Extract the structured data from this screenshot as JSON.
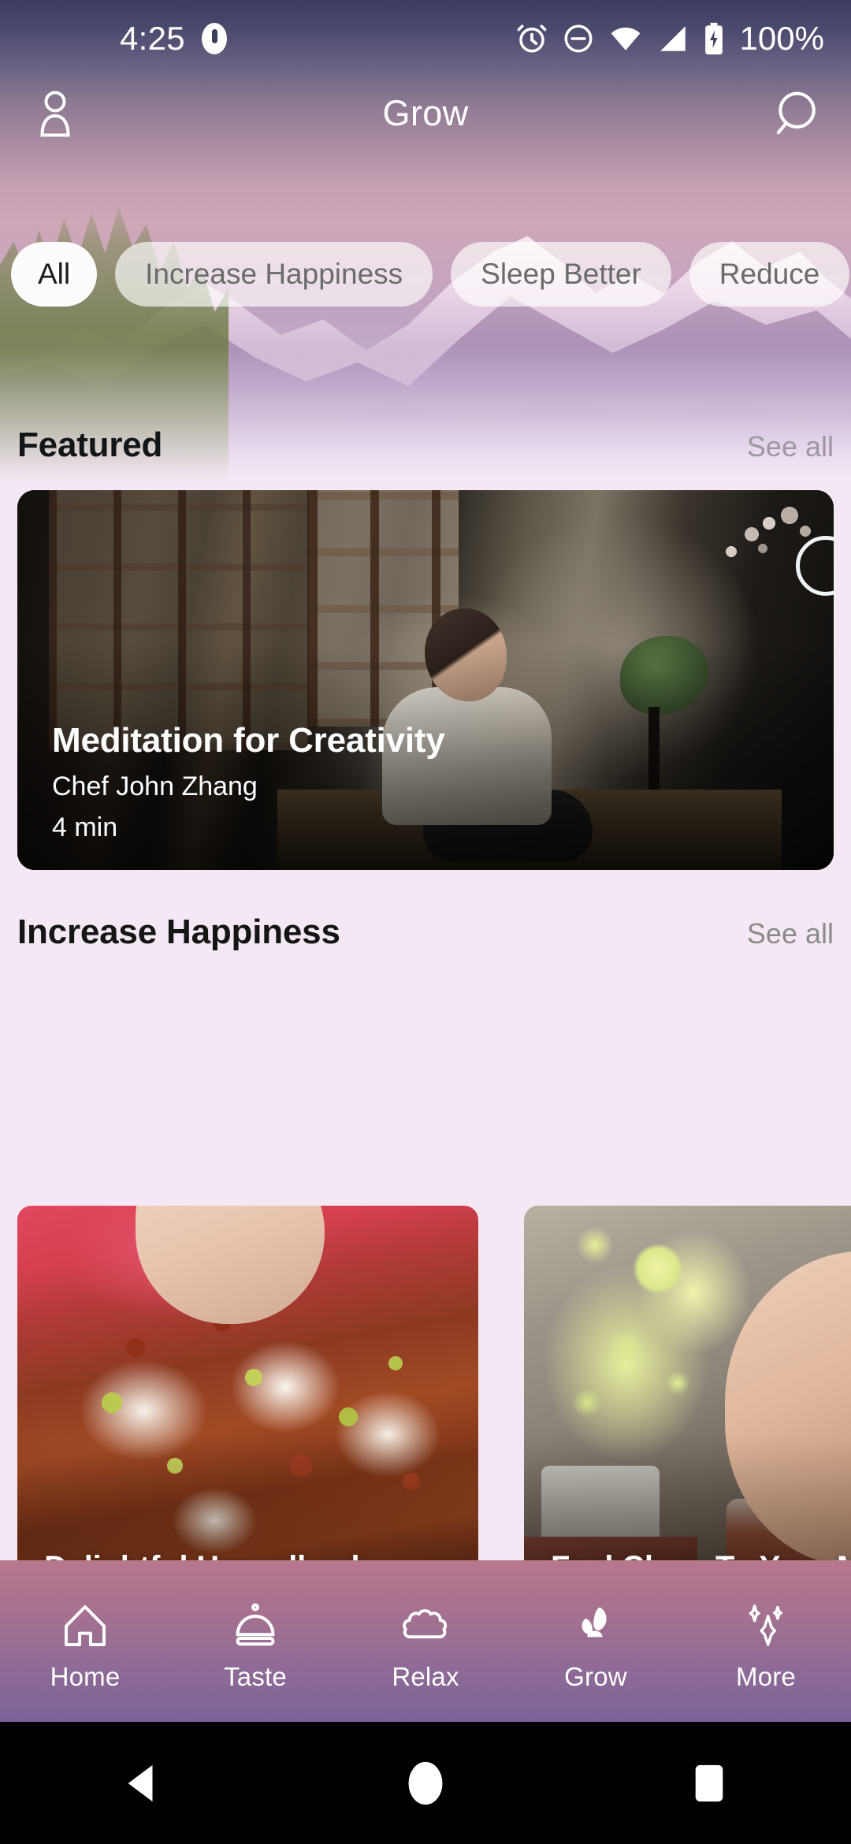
{
  "status_bar": {
    "time": "4:25",
    "battery_percent": "100%",
    "icons": [
      "notification-icon",
      "alarm-icon",
      "do-not-disturb-icon",
      "wifi-icon",
      "cellular-signal-icon",
      "battery-icon"
    ]
  },
  "app_bar": {
    "title": "Grow",
    "profile_icon": "profile-icon",
    "search_icon": "search-icon"
  },
  "chips": [
    {
      "label": "All",
      "active": true
    },
    {
      "label": "Increase Happiness",
      "active": false
    },
    {
      "label": "Sleep Better",
      "active": false
    },
    {
      "label": "Reduce",
      "active": false
    }
  ],
  "sections": [
    {
      "title": "Featured",
      "see_all": "See all",
      "featured_card": {
        "title": "Meditation for Creativity",
        "author": "Chef John Zhang",
        "duration": "4 min",
        "play_icon": "play-circle-icon"
      }
    },
    {
      "title": "Increase Happiness",
      "see_all": "See all",
      "cards": [
        {
          "title": "Delightful Hasselback Potatoes and a Surp"
        },
        {
          "title": "Feel Close To Your More When You"
        }
      ]
    }
  ],
  "bottom_nav": [
    {
      "label": "Home",
      "icon": "home-icon",
      "active": false
    },
    {
      "label": "Taste",
      "icon": "cloche-icon",
      "active": false
    },
    {
      "label": "Relax",
      "icon": "cloud-icon",
      "active": false
    },
    {
      "label": "Grow",
      "icon": "sprout-icon",
      "active": true
    },
    {
      "label": "More",
      "icon": "sparkle-icon",
      "active": false
    }
  ],
  "system_nav": [
    {
      "name": "back-button",
      "icon": "triangle-left-icon"
    },
    {
      "name": "home-button",
      "icon": "circle-icon"
    },
    {
      "name": "recents-button",
      "icon": "square-icon"
    }
  ],
  "colors": {
    "page_background": "#f4e8f4",
    "chip_active_bg": "#fdfbfd",
    "chip_inactive_bg": "rgba(255,255,255,0.66)",
    "nav_gradient_start": "#b7788d",
    "nav_gradient_end": "#7d639a",
    "see_all_text": "#8c8a8c"
  }
}
